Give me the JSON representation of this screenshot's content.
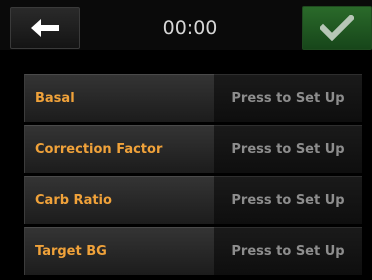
{
  "header": {
    "back_icon": "left-arrow-icon",
    "time": "00:00",
    "confirm_icon": "checkmark-icon"
  },
  "settings": [
    {
      "label": "Basal",
      "value": "Press to Set Up"
    },
    {
      "label": "Correction Factor",
      "value": "Press to Set Up"
    },
    {
      "label": "Carb Ratio",
      "value": "Press to Set Up"
    },
    {
      "label": "Target BG",
      "value": "Press to Set Up"
    }
  ],
  "colors": {
    "label_text": "#f0a23a",
    "value_text": "#8d8d8d",
    "confirm_button": "#2a6a2a",
    "background": "#000000"
  }
}
